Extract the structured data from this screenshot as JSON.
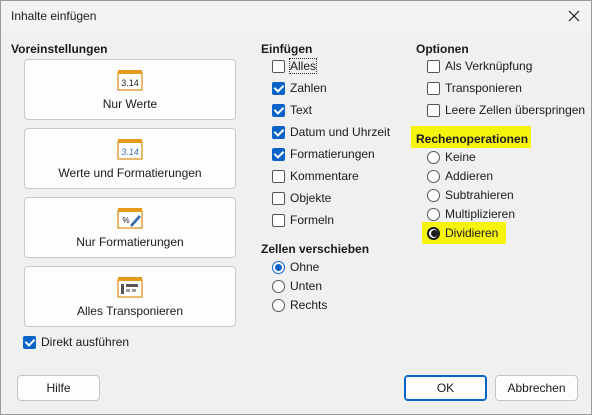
{
  "window": {
    "title": "Inhalte einfügen"
  },
  "presets": {
    "heading": "Voreinstellungen",
    "items": [
      {
        "label": "Nur Werte",
        "icon": "values-only-icon",
        "icon_text": "3.14"
      },
      {
        "label": "Werte und Formatierungen",
        "icon": "values-formats-icon",
        "icon_text": "3.14"
      },
      {
        "label": "Nur Formatierungen",
        "icon": "formats-only-icon"
      },
      {
        "label": "Alles Transponieren",
        "icon": "transpose-all-icon"
      }
    ],
    "direct_label": "Direkt ausführen",
    "direct_checked": true
  },
  "insert": {
    "heading": "Einfügen",
    "items": [
      {
        "label": "Alles",
        "checked": false
      },
      {
        "label": "Zahlen",
        "checked": true
      },
      {
        "label": "Text",
        "checked": true
      },
      {
        "label": "Datum und Uhrzeit",
        "checked": true
      },
      {
        "label": "Formatierungen",
        "checked": true
      },
      {
        "label": "Kommentare",
        "checked": false
      },
      {
        "label": "Objekte",
        "checked": false
      },
      {
        "label": "Formeln",
        "checked": false
      }
    ]
  },
  "shift": {
    "heading": "Zellen verschieben",
    "items": [
      {
        "label": "Ohne",
        "checked": true
      },
      {
        "label": "Unten",
        "checked": false
      },
      {
        "label": "Rechts",
        "checked": false
      }
    ]
  },
  "options": {
    "heading": "Optionen",
    "items": [
      {
        "label": "Als Verknüpfung",
        "checked": false
      },
      {
        "label": "Transponieren",
        "checked": false
      },
      {
        "label": "Leere Zellen überspringen",
        "checked": false
      }
    ]
  },
  "operations": {
    "heading": "Rechenoperationen",
    "items": [
      {
        "label": "Keine",
        "checked": false
      },
      {
        "label": "Addieren",
        "checked": false
      },
      {
        "label": "Subtrahieren",
        "checked": false
      },
      {
        "label": "Multiplizieren",
        "checked": false
      },
      {
        "label": "Dividieren",
        "checked": true
      }
    ],
    "highlight_color": "#f6f30f"
  },
  "footer": {
    "help": "Hilfe",
    "ok": "OK",
    "cancel": "Abbrechen"
  },
  "colors": {
    "accent": "#0a63c9",
    "highlight": "#f6f30f"
  }
}
